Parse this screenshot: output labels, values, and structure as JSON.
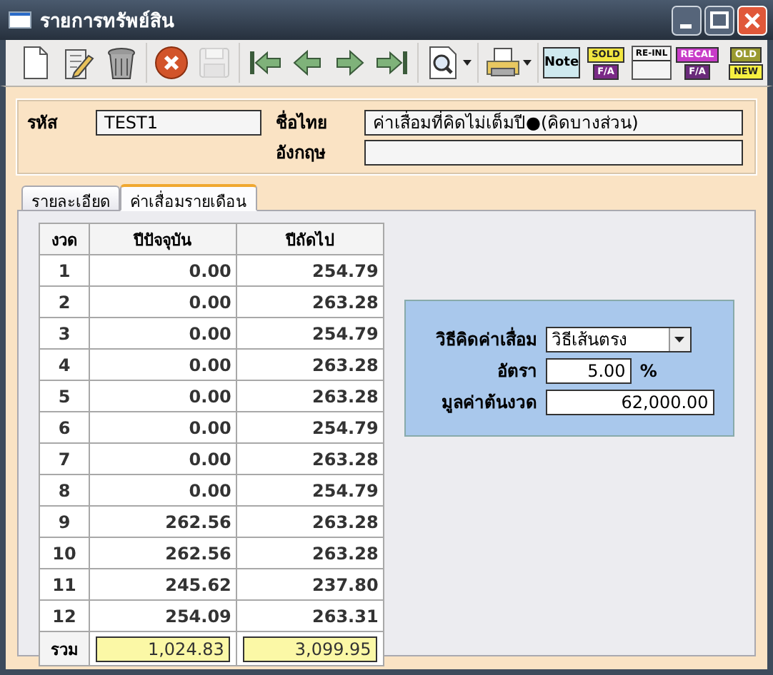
{
  "window": {
    "title": "รายการทรัพย์สิน"
  },
  "toolbar": {
    "groups": [
      [
        {
          "kind": "new",
          "disabled": false
        },
        {
          "kind": "edit",
          "disabled": false
        },
        {
          "kind": "delete",
          "disabled": false
        }
      ],
      [
        {
          "kind": "cancel",
          "disabled": false
        },
        {
          "kind": "save",
          "disabled": true
        }
      ],
      [
        {
          "kind": "first",
          "disabled": false
        },
        {
          "kind": "prev",
          "disabled": false
        },
        {
          "kind": "next",
          "disabled": false
        },
        {
          "kind": "last",
          "disabled": false
        }
      ],
      [
        {
          "kind": "search",
          "disabled": false
        }
      ],
      [
        {
          "kind": "print",
          "disabled": false
        }
      ],
      [
        {
          "kind": "note",
          "disabled": false,
          "labels": [
            "Note"
          ]
        },
        {
          "kind": "sold",
          "disabled": false,
          "labels": [
            "SOLD",
            "F/A"
          ]
        },
        {
          "kind": "report",
          "disabled": false,
          "labels": [
            "RE-INL"
          ]
        },
        {
          "kind": "recal",
          "disabled": false,
          "labels": [
            "RECAL",
            "F/A"
          ]
        },
        {
          "kind": "oldnew",
          "disabled": false,
          "labels": [
            "OLD",
            "NEW"
          ]
        }
      ]
    ]
  },
  "header": {
    "code": {
      "label": "รหัส",
      "value": "TEST1"
    },
    "name_thai": {
      "label": "ชื่อไทย",
      "value": "ค่าเสื่อมที่คิดไม่เต็มปี●(คิดบางส่วน)"
    },
    "name_english": {
      "label": "อังกฤษ"
    }
  },
  "tabs": [
    {
      "label": "รายละเอียด",
      "selected": false
    },
    {
      "label": "ค่าเสื่อมรายเดือน",
      "selected": true
    }
  ],
  "table": {
    "columns": [
      "งวด",
      "ปีปัจจุบัน",
      "ปีถัดไป"
    ],
    "rows": [
      [
        "1",
        "0.00",
        "254.79"
      ],
      [
        "2",
        "0.00",
        "263.28"
      ],
      [
        "3",
        "0.00",
        "254.79"
      ],
      [
        "4",
        "0.00",
        "263.28"
      ],
      [
        "5",
        "0.00",
        "263.28"
      ],
      [
        "6",
        "0.00",
        "254.79"
      ],
      [
        "7",
        "0.00",
        "263.28"
      ],
      [
        "8",
        "0.00",
        "254.79"
      ],
      [
        "9",
        "262.56",
        "263.28"
      ],
      [
        "10",
        "262.56",
        "263.28"
      ],
      [
        "11",
        "245.62",
        "237.80"
      ],
      [
        "12",
        "254.09",
        "263.31"
      ]
    ],
    "total": {
      "label": "รวม",
      "values": [
        "1,024.83",
        "3,099.95"
      ]
    }
  },
  "settings": {
    "method": {
      "label": "วิธีคิดค่าเสื่อม",
      "value": "วิธีเส้นตรง"
    },
    "rate": {
      "label": "อัตรา",
      "value": "5.00",
      "unit": "%"
    },
    "start_value": {
      "label": "มูลค่าต้นงวด",
      "value": "62,000.00"
    }
  }
}
